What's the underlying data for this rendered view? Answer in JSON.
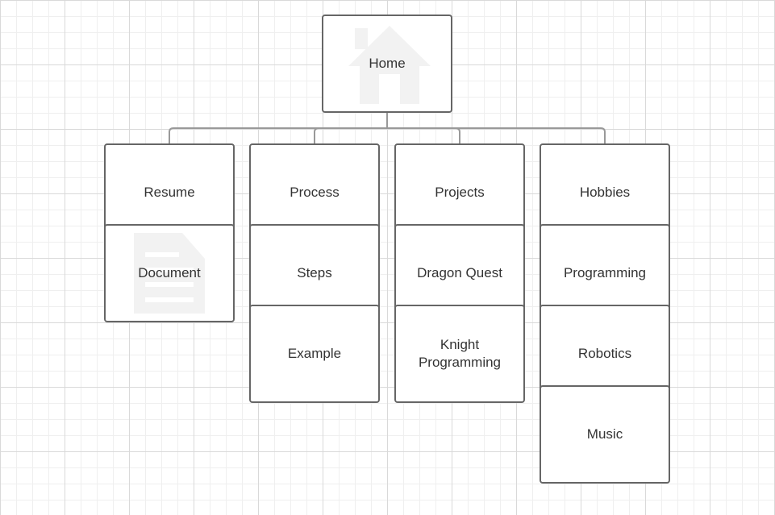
{
  "diagram": {
    "root": {
      "label": "Home",
      "icon": "home-icon"
    },
    "columns": [
      {
        "key": "resume",
        "items": [
          {
            "label": "Resume"
          },
          {
            "label": "Document",
            "icon": "document-icon"
          }
        ]
      },
      {
        "key": "process",
        "items": [
          {
            "label": "Process"
          },
          {
            "label": "Steps"
          },
          {
            "label": "Example"
          }
        ]
      },
      {
        "key": "projects",
        "items": [
          {
            "label": "Projects"
          },
          {
            "label": "Dragon Quest"
          },
          {
            "label": "Knight Programming"
          }
        ]
      },
      {
        "key": "hobbies",
        "items": [
          {
            "label": "Hobbies"
          },
          {
            "label": "Programming"
          },
          {
            "label": "Robotics"
          },
          {
            "label": "Music"
          }
        ]
      }
    ],
    "colors": {
      "border": "#666666",
      "connector": "#999999",
      "text": "#333333",
      "icon_watermark": "#f2f2f2",
      "grid_major": "#d9d9d9",
      "grid_minor": "#efefef"
    }
  }
}
